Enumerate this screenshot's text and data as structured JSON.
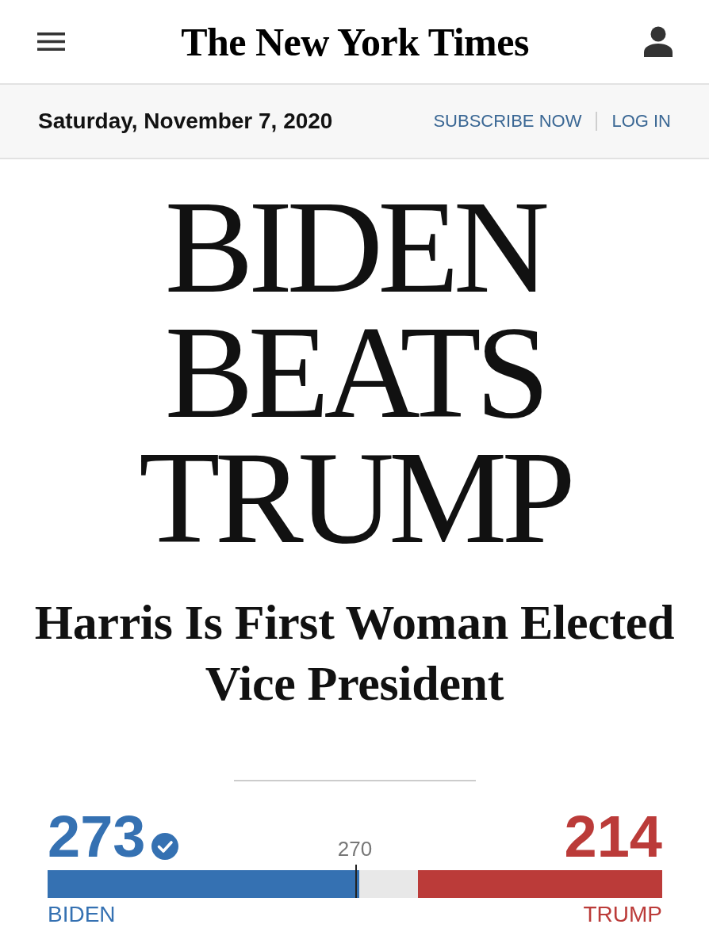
{
  "header": {
    "logo": "The New York Times"
  },
  "date_bar": {
    "date": "Saturday, November 7, 2020",
    "links": [
      "SUBSCRIBE NOW",
      "LOG IN"
    ]
  },
  "headline": "BIDEN BEATS TRUMP",
  "subheadline": "Harris Is First Woman Elected Vice President",
  "electoral_votes": {
    "threshold": "270",
    "candidates": [
      {
        "name": "BIDEN",
        "votes": "273",
        "winner": true,
        "color": "#3571b2",
        "level": 0.507
      },
      {
        "name": "TRUMP",
        "votes": "214",
        "winner": false,
        "color": "#bb3b39",
        "level": 0.398
      }
    ]
  }
}
